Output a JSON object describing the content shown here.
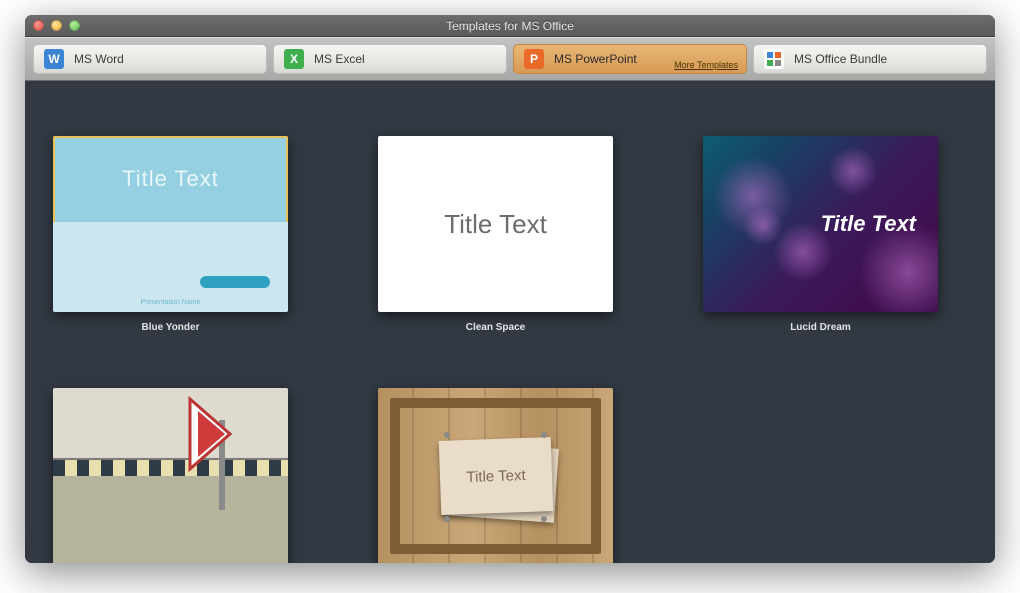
{
  "window": {
    "title": "Templates for MS Office"
  },
  "tabs": [
    {
      "label": "MS Word",
      "icon_char": "W",
      "icon_name": "word-icon"
    },
    {
      "label": "MS Excel",
      "icon_char": "X",
      "icon_name": "excel-icon"
    },
    {
      "label": "MS PowerPoint",
      "icon_char": "P",
      "icon_name": "powerpoint-icon",
      "more_link": "More Templates"
    },
    {
      "label": "MS Office Bundle",
      "icon_char": "",
      "icon_name": "bundle-icon"
    }
  ],
  "templates": [
    {
      "name": "Blue Yonder",
      "slide_title": "Title Text",
      "footer_text": "Presentation Name"
    },
    {
      "name": "Clean Space",
      "slide_title": "Title Text"
    },
    {
      "name": "Lucid Dream",
      "slide_title": "Title Text"
    },
    {
      "name": "",
      "slide_title": ""
    },
    {
      "name": "",
      "slide_title": "Title Text"
    }
  ]
}
